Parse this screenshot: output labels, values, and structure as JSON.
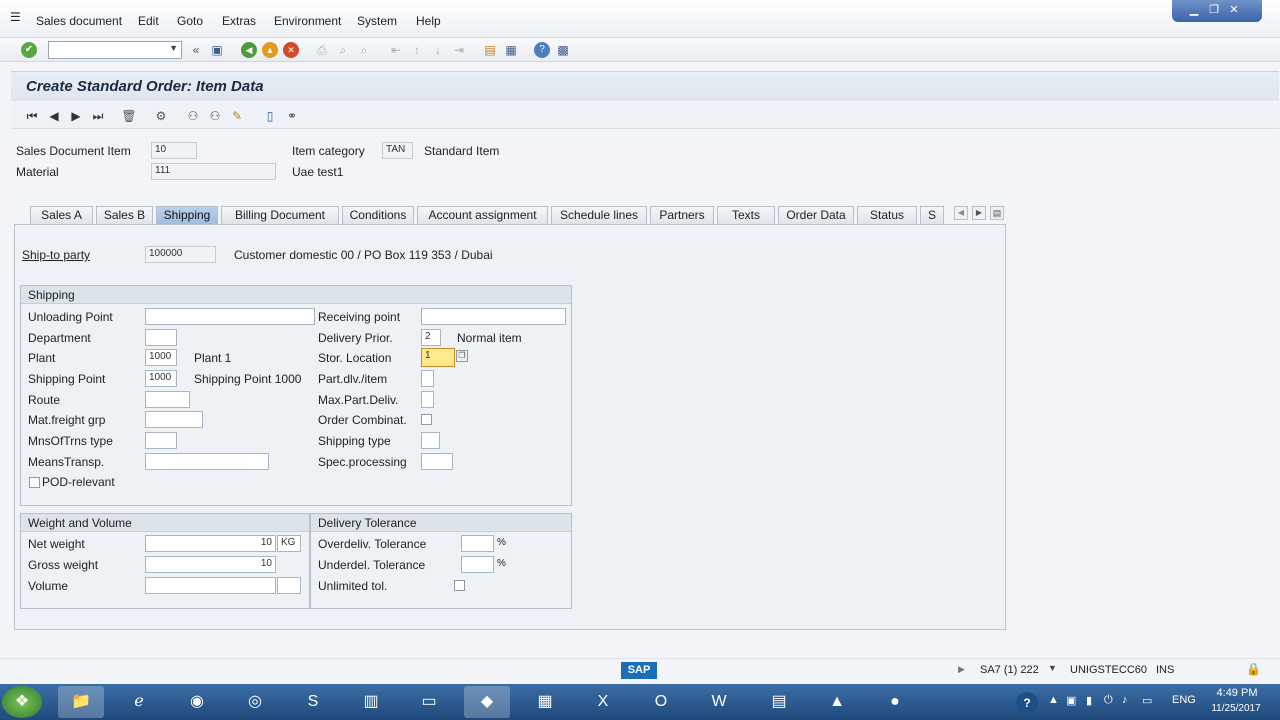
{
  "menu": [
    "Sales document",
    "Edit",
    "Goto",
    "Extras",
    "Environment",
    "System",
    "Help"
  ],
  "title": "Create Standard Order: Item Data",
  "header": {
    "sales_doc_item_label": "Sales Document Item",
    "sales_doc_item_value": "10",
    "item_category_label": "Item category",
    "item_category_value": "TAN",
    "item_category_text": "Standard Item",
    "material_label": "Material",
    "material_value": "111",
    "material_text": "Uae test1"
  },
  "tabs": [
    "Sales A",
    "Sales B",
    "Shipping",
    "Billing Document",
    "Conditions",
    "Account assignment",
    "Schedule lines",
    "Partners",
    "Texts",
    "Order Data",
    "Status",
    "S"
  ],
  "active_tab": "Shipping",
  "ship_to": {
    "label": "Ship-to party",
    "value": "100000",
    "text": "Customer domestic 00 / PO Box 119 353 / Dubai"
  },
  "shipping": {
    "title": "Shipping",
    "unloading_point": "Unloading Point",
    "department": "Department",
    "plant_label": "Plant",
    "plant_value": "1000",
    "plant_text": "Plant 1",
    "shipping_point_label": "Shipping Point",
    "shipping_point_value": "1000",
    "shipping_point_text": "Shipping Point 1000",
    "route": "Route",
    "mat_freight_grp": "Mat.freight grp",
    "mns_of_trns_type": "MnsOfTrns type",
    "means_transp": "MeansTransp.",
    "pod_relevant": "POD-relevant",
    "receiving_point": "Receiving point",
    "delivery_prior_label": "Delivery Prior.",
    "delivery_prior_value": "2",
    "delivery_prior_text": "Normal item",
    "stor_location_label": "Stor. Location",
    "stor_location_value": "1",
    "part_dlv_item": "Part.dlv./item",
    "max_part_deliv": "Max.Part.Deliv.",
    "order_combinat": "Order Combinat.",
    "shipping_type": "Shipping type",
    "spec_processing": "Spec.processing"
  },
  "weight": {
    "title": "Weight and Volume",
    "net_weight_label": "Net weight",
    "net_weight_value": "10",
    "unit": "KG",
    "gross_weight_label": "Gross weight",
    "gross_weight_value": "10",
    "volume_label": "Volume"
  },
  "tolerance": {
    "title": "Delivery Tolerance",
    "overdeliv_label": "Overdeliv. Tolerance",
    "underdel_label": "Underdel. Tolerance",
    "percent": "%",
    "unlimited_label": "Unlimited tol."
  },
  "status": {
    "system": "SA7 (1) 222",
    "server": "UNIGSTECC60",
    "mode": "INS",
    "logo": "SAP"
  },
  "clock": {
    "time": "4:49 PM",
    "date": "11/25/2017",
    "lang": "ENG"
  },
  "colors": {
    "accent": "#1f4a7d",
    "active_tab": "#a8c4e5",
    "focus_field": "#ffe98a"
  }
}
